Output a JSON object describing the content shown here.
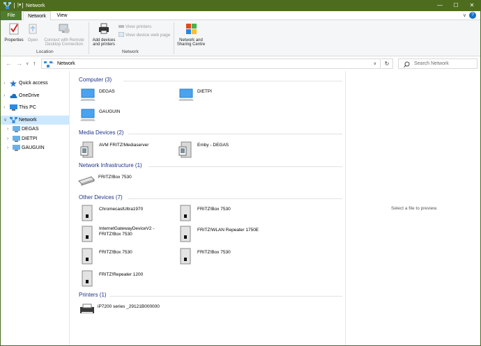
{
  "window": {
    "title": "Network",
    "tb_down": "|▾",
    "minimize": "—",
    "maximize": "☐",
    "close": "✕"
  },
  "tabs": {
    "file": "File",
    "network": "Network",
    "view": "View",
    "chevron": "∨",
    "help": "?"
  },
  "ribbon": {
    "properties": "Properties",
    "open": "Open",
    "connect_remote": [
      "Connect with Remote",
      "Desktop Connection"
    ],
    "location_group": "Location",
    "add_devices": [
      "Add devices",
      "and printers"
    ],
    "view_printers": "View printers",
    "view_device_web_page": "View device web page",
    "network_sharing": [
      "Network and",
      "Sharing Centre"
    ],
    "network_group": "Network"
  },
  "address": {
    "back": "←",
    "forward": "→",
    "recent": "∨",
    "up": "↑",
    "path": "Network",
    "dropdown": "∨",
    "refresh": "↻",
    "search_placeholder": "Search Network"
  },
  "nav_pane": {
    "items": [
      {
        "label": "Quick access",
        "icon": "star-icon"
      },
      {
        "label": "OneDrive",
        "icon": "cloud-icon"
      },
      {
        "label": "This PC",
        "icon": "computer-icon"
      },
      {
        "label": "Network",
        "icon": "network-icon",
        "selected": true
      },
      {
        "label": "DEGAS",
        "icon": "computer-icon"
      },
      {
        "label": "DIETPI",
        "icon": "computer-icon"
      },
      {
        "label": "GAUGUIN",
        "icon": "computer-icon"
      }
    ],
    "arrows": {
      "collapsed": "›",
      "expanded": "∨"
    }
  },
  "groups": {
    "computer": {
      "label": "Computer (3)",
      "items": [
        "DEGAS",
        "DIETPI",
        "GAUGUIN"
      ]
    },
    "media": {
      "label": "Media Devices (2)",
      "items": [
        "AVM FRITZ!Mediaserver",
        "Emby - DEGAS"
      ]
    },
    "infra": {
      "label": "Network Infrastructure (1)",
      "items": [
        "FRITZ!Box 7530"
      ]
    },
    "other": {
      "label": "Other Devices (7)",
      "items": [
        "ChromecastUltra1970",
        "FRITZ!Box 7530",
        "InternetGatewayDeviceV2 -",
        "FRITZ!Box 7530",
        "FRITZ!WLAN Repeater 1750E",
        "FRITZ!Box 7530",
        "FRITZ!Box 7530",
        "FRITZ!Repeater 1200"
      ]
    },
    "printers": {
      "label": "Printers (1)",
      "items": [
        "iP7200 series _29121B000000"
      ]
    }
  },
  "preview": {
    "message": "Select a file to preview."
  },
  "colors": {
    "titlebar": "#4e6c1d",
    "file_tab": "#4e7d2e",
    "group_header": "#1e3287",
    "selected": "#cce8ff"
  }
}
